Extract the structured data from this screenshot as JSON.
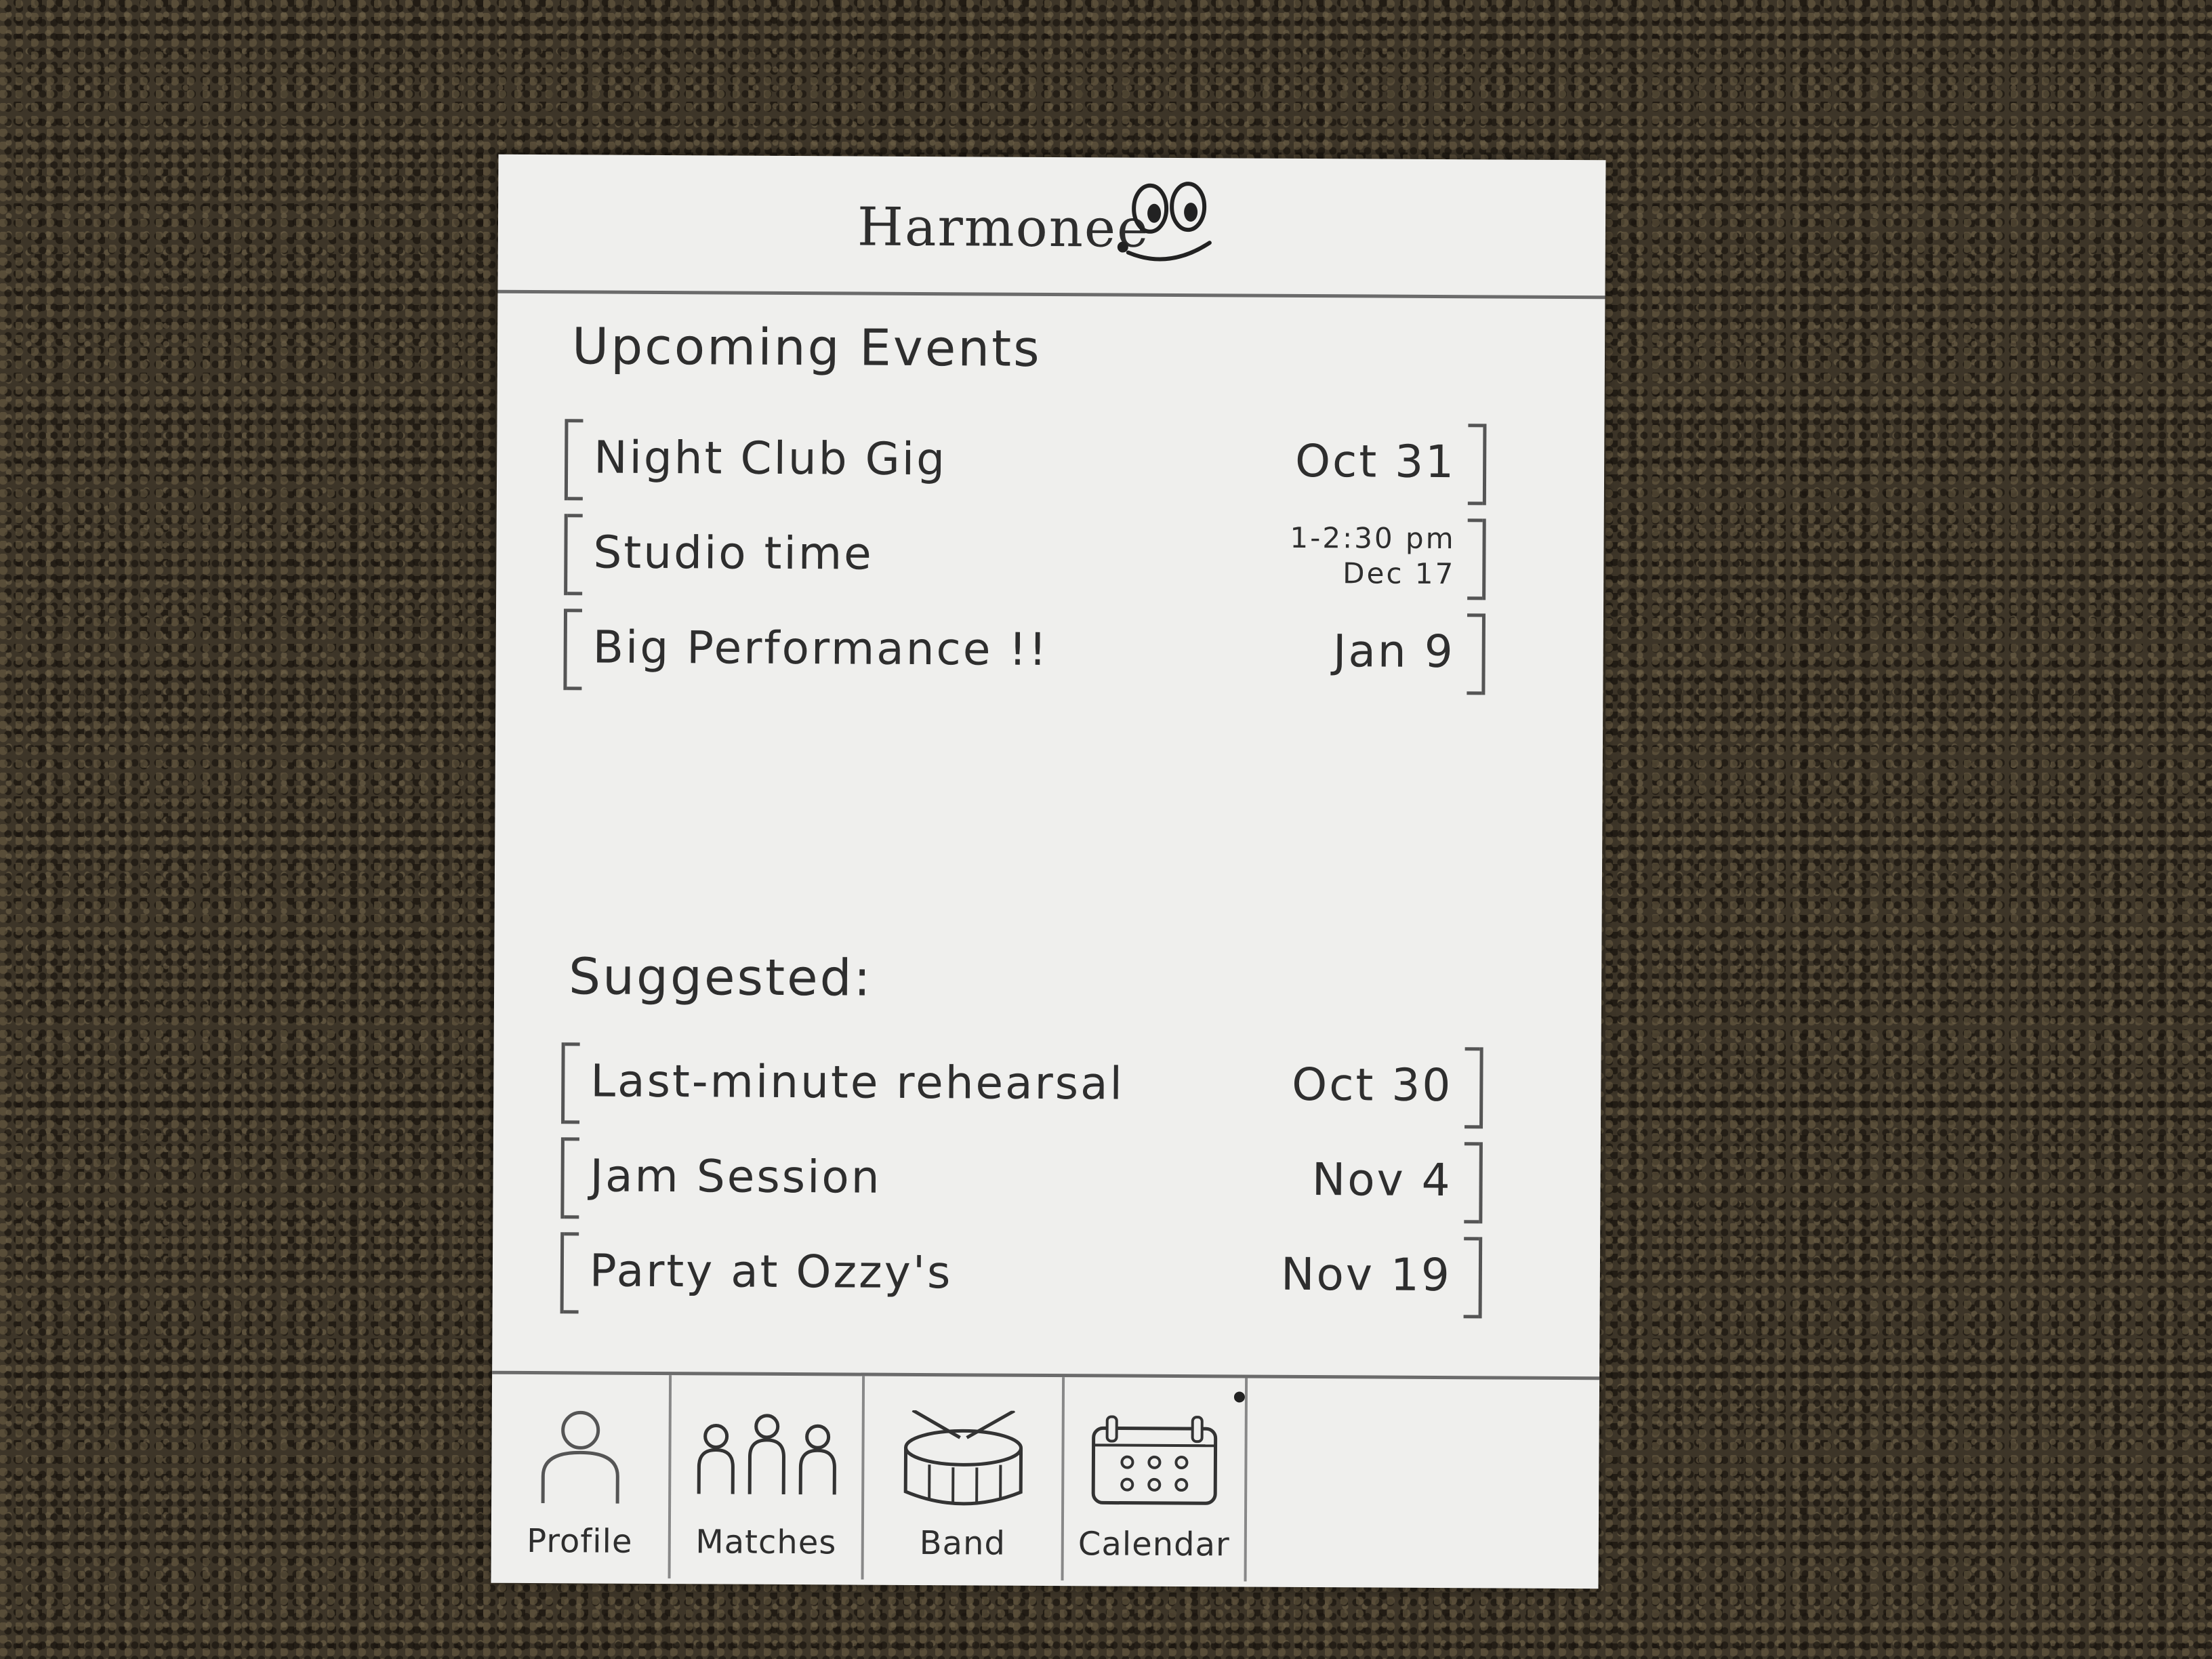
{
  "app": {
    "title": "Harmonee"
  },
  "upcoming": {
    "title": "Upcoming Events",
    "items": [
      {
        "name": "Night Club Gig",
        "date": "Oct 31"
      },
      {
        "name": "Studio time",
        "time": "1-2:30 pm",
        "date": "Dec 17"
      },
      {
        "name": "Big Performance !!",
        "date": "Jan 9"
      }
    ]
  },
  "suggested": {
    "title": "Suggested:",
    "items": [
      {
        "name": "Last-minute rehearsal",
        "date": "Oct 30"
      },
      {
        "name": "Jam Session",
        "date": "Nov 4"
      },
      {
        "name": "Party at Ozzy's",
        "date": "Nov 19"
      }
    ]
  },
  "nav": {
    "items": [
      {
        "label": "Profile",
        "icon": "person-icon"
      },
      {
        "label": "Matches",
        "icon": "group-icon"
      },
      {
        "label": "Band",
        "icon": "drum-icon"
      },
      {
        "label": "Calendar",
        "icon": "calendar-icon"
      }
    ]
  }
}
